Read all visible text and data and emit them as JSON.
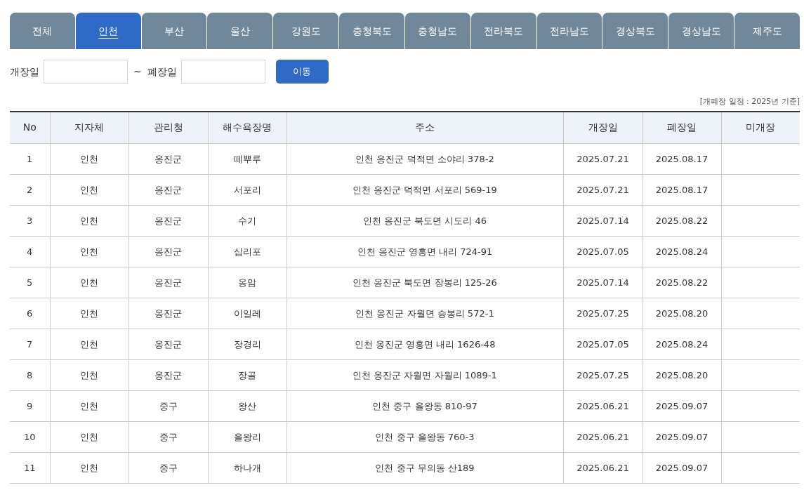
{
  "tabs": [
    {
      "label": "전체",
      "selected": false
    },
    {
      "label": "인천",
      "selected": true
    },
    {
      "label": "부산",
      "selected": false
    },
    {
      "label": "울산",
      "selected": false
    },
    {
      "label": "강원도",
      "selected": false
    },
    {
      "label": "충청북도",
      "selected": false
    },
    {
      "label": "충청남도",
      "selected": false
    },
    {
      "label": "전라북도",
      "selected": false
    },
    {
      "label": "전라남도",
      "selected": false
    },
    {
      "label": "경상북도",
      "selected": false
    },
    {
      "label": "경상남도",
      "selected": false
    },
    {
      "label": "제주도",
      "selected": false
    }
  ],
  "filter": {
    "open_label": "개장일",
    "separator": "~",
    "close_label": "폐장일",
    "button": "이동"
  },
  "note": "[개폐장 일정 : 2025년 기준]",
  "table": {
    "columns": [
      "No",
      "지자체",
      "관리청",
      "해수욕장명",
      "주소",
      "개장일",
      "폐장일",
      "미개장"
    ],
    "rows": [
      [
        "1",
        "인천",
        "옹진군",
        "떼뿌루",
        "인천 옹진군 덕적면 소야리 378-2",
        "2025.07.21",
        "2025.08.17"
      ],
      [
        "2",
        "인천",
        "옹진군",
        "서포리",
        "인천 옹진군 덕적면 서포리 569-19",
        "2025.07.21",
        "2025.08.17"
      ],
      [
        "3",
        "인천",
        "옹진군",
        "수기",
        "인천 옹진군 북도면 시도리 46",
        "2025.07.14",
        "2025.08.22"
      ],
      [
        "4",
        "인천",
        "옹진군",
        "십리포",
        "인천 옹진군 영흥면 내리 724-91",
        "2025.07.05",
        "2025.08.24"
      ],
      [
        "5",
        "인천",
        "옹진군",
        "옹암",
        "인천 옹진군 북도면 장봉리 125-26",
        "2025.07.14",
        "2025.08.22"
      ],
      [
        "6",
        "인천",
        "옹진군",
        "이일레",
        "인천 옹진군 자월면 승봉리 572-1",
        "2025.07.25",
        "2025.08.20"
      ],
      [
        "7",
        "인천",
        "옹진군",
        "장경리",
        "인천 옹진군 영흥면 내리 1626-48",
        "2025.07.05",
        "2025.08.24"
      ],
      [
        "8",
        "인천",
        "옹진군",
        "장골",
        "인천 옹진군 자월면 자월리 1089-1",
        "2025.07.25",
        "2025.08.20"
      ],
      [
        "9",
        "인천",
        "중구",
        "왕산",
        "인천 중구 을왕동 810-97",
        "2025.06.21",
        "2025.09.07"
      ],
      [
        "10",
        "인천",
        "중구",
        "을왕리",
        "인천 중구 을왕동 760-3",
        "2025.06.21",
        "2025.09.07"
      ],
      [
        "11",
        "인천",
        "중구",
        "하나개",
        "인천 중구 무의동 산189",
        "2025.06.21",
        "2025.09.07"
      ]
    ]
  }
}
